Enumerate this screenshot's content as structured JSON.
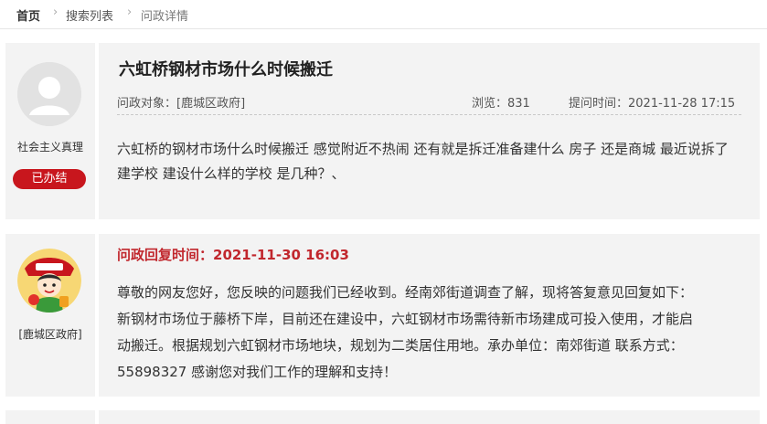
{
  "breadcrumb": {
    "home": "首页",
    "list": "搜索列表",
    "current": "问政详情",
    "separator": "›"
  },
  "question": {
    "user_name": "社会主义真理",
    "status": "已办结",
    "title": "六虹桥钢材市场什么时候搬迁",
    "target_label": "问政对象：[鹿城区政府]",
    "views_label": "浏览：831",
    "time_label": "提问时间：2021-11-28 17:15",
    "content": "六虹桥的钢材市场什么时候搬迁 感觉附近不热闹 还有就是拆迁准备建什么 房子 还是商城 最近说拆了建学校 建设什么样的学校 是几种？、"
  },
  "reply": {
    "org_name": "[鹿城区政府]",
    "time_label": "问政回复时间：2021-11-30 16:03",
    "content": "尊敬的网友您好，您反映的问题我们已经收到。经南郊街道调查了解，现将答复意见回复如下：新钢材市场位于藤桥下岸，目前还在建设中，六虹钢材市场需待新市场建成可投入使用，才能启动搬迁。根据规划六虹钢材市场地块，规划为二类居住用地。承办单位：南郊街道 联系方式：55898327 感谢您对我们工作的理解和支持！"
  },
  "colors": {
    "accent": "#c1272d",
    "badge": "#c8161d",
    "panel": "#f3f3f3"
  },
  "icons": {
    "user_avatar": "default-user-avatar-icon",
    "org_avatar": "government-mascot-avatar-icon"
  }
}
